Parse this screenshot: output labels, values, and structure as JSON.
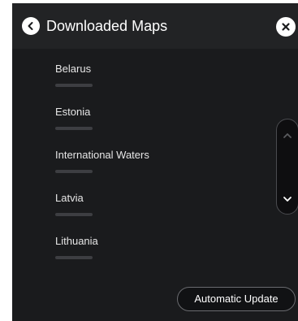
{
  "header": {
    "title": "Downloaded Maps"
  },
  "maps": [
    {
      "name": "Belarus"
    },
    {
      "name": "Estonia"
    },
    {
      "name": "International Waters"
    },
    {
      "name": "Latvia"
    },
    {
      "name": "Lithuania"
    }
  ],
  "footer": {
    "automatic_update_label": "Automatic Update"
  },
  "icons": {
    "back": "chevron-left-icon",
    "close": "close-icon",
    "scroll_up": "chevron-up-icon",
    "scroll_down": "chevron-down-icon"
  },
  "colors": {
    "background": "#1a1b1d",
    "text": "#ffffff",
    "button_outline": "#6a6b6f"
  }
}
